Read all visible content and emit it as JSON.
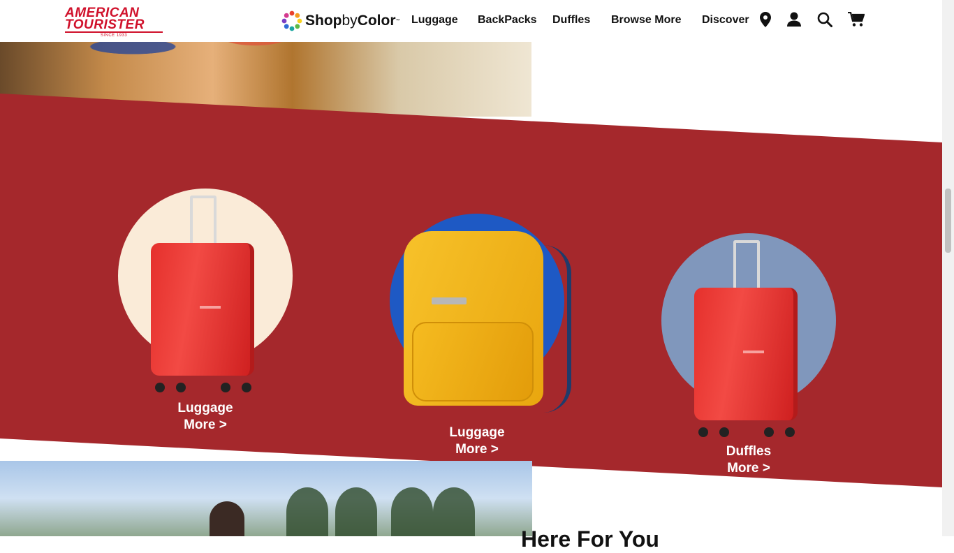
{
  "brand": {
    "logo_line1": "AMERICAN",
    "logo_line2": "TOURISTER",
    "logo_tagline": "SINCE 1933",
    "accent": "#d0112b"
  },
  "shop_by_color": {
    "part1": "Shop",
    "part2": "by",
    "part3": "Color",
    "tm": "™"
  },
  "nav": {
    "items": [
      "Luggage",
      "BackPacks",
      "Duffles",
      "Browse More",
      "Discover"
    ],
    "icons": [
      "location-icon",
      "account-icon",
      "search-icon",
      "cart-icon"
    ]
  },
  "banner": {
    "color": "#a5282c",
    "cards": [
      {
        "title": "Luggage",
        "link": "More >",
        "circle_color": "#faebd8",
        "product": "red suitcase"
      },
      {
        "title": "Luggage",
        "link": "More >",
        "circle_color": "#1e59c4",
        "product": "yellow backpack"
      },
      {
        "title": "Duffles",
        "link": "More >",
        "circle_color": "#8097bc",
        "product": "red suitcase"
      }
    ]
  },
  "next_section": {
    "heading_partial": "Here For You"
  }
}
